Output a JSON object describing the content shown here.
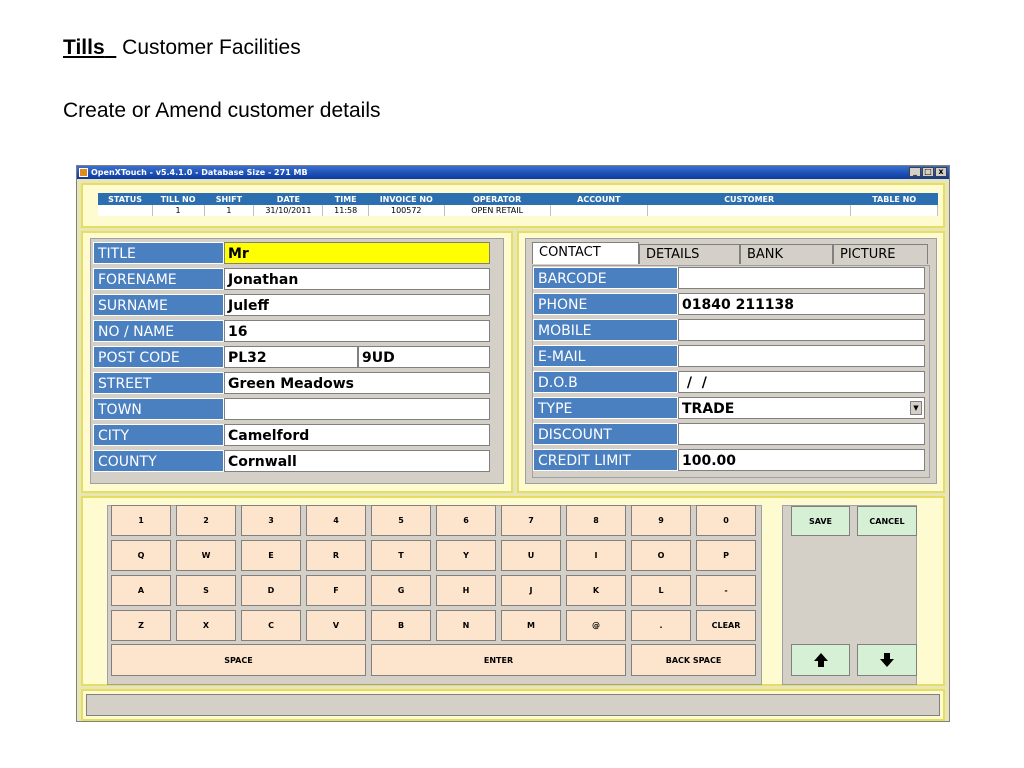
{
  "slide": {
    "title_bold": "Tills",
    "title_rest": "Customer Facilities",
    "subtitle": "Create or Amend customer details"
  },
  "window": {
    "title": "OpenXTouch - v5.4.1.0 - Database Size - 271 MB",
    "controls": [
      "_",
      "□",
      "x"
    ]
  },
  "status": {
    "headers": [
      "STATUS",
      "TILL NO",
      "SHIFT",
      "DATE",
      "TIME",
      "INVOICE NO",
      "OPERATOR",
      "ACCOUNT",
      "CUSTOMER",
      "TABLE NO"
    ],
    "values": [
      "",
      "1",
      "1",
      "31/10/2011",
      "11:58",
      "100572",
      "OPEN RETAIL",
      "",
      "",
      ""
    ]
  },
  "address": {
    "title_label": "TITLE",
    "title_value": "Mr",
    "forename_label": "FORENAME",
    "forename_value": "Jonathan",
    "surname_label": "SURNAME",
    "surname_value": "Juleff",
    "no_name_label": "NO / NAME",
    "no_name_value": "16",
    "postcode_label": "POST CODE",
    "postcode_part1": "PL32",
    "postcode_part2": "9UD",
    "street_label": "STREET",
    "street_value": "Green Meadows",
    "town_label": "TOWN",
    "town_value": "",
    "city_label": "CITY",
    "city_value": "Camelford",
    "county_label": "COUNTY",
    "county_value": "Cornwall"
  },
  "tabs": [
    "CONTACT",
    "DETAILS",
    "BANK",
    "PICTURE"
  ],
  "contact": {
    "barcode_label": "BARCODE",
    "barcode_value": "",
    "phone_label": "PHONE",
    "phone_value": "01840 211138",
    "mobile_label": "MOBILE",
    "mobile_value": "",
    "email_label": "E-MAIL",
    "email_value": "",
    "dob_label": "D.O.B",
    "dob_value": " /  /",
    "type_label": "TYPE",
    "type_value": "TRADE",
    "discount_label": "DISCOUNT",
    "discount_value": "",
    "credit_label": "CREDIT LIMIT",
    "credit_value": "100.00"
  },
  "keyboard": {
    "row1": [
      "1",
      "2",
      "3",
      "4",
      "5",
      "6",
      "7",
      "8",
      "9",
      "0"
    ],
    "row2": [
      "Q",
      "W",
      "E",
      "R",
      "T",
      "Y",
      "U",
      "I",
      "O",
      "P"
    ],
    "row3": [
      "A",
      "S",
      "D",
      "F",
      "G",
      "H",
      "J",
      "K",
      "L",
      "-"
    ],
    "row4": [
      "Z",
      "X",
      "C",
      "V",
      "B",
      "N",
      "M",
      "@",
      ".",
      "CLEAR"
    ],
    "space": "SPACE",
    "enter": "ENTER",
    "backspace": "BACK SPACE"
  },
  "actions": {
    "save": "SAVE",
    "cancel": "CANCEL"
  },
  "colors": {
    "label_blue": "#4a7fc0",
    "key_peach": "#fde4cc",
    "action_green": "#d6f0d6",
    "frame_yellow": "#e6de60",
    "highlight_yellow": "#ffff00"
  }
}
